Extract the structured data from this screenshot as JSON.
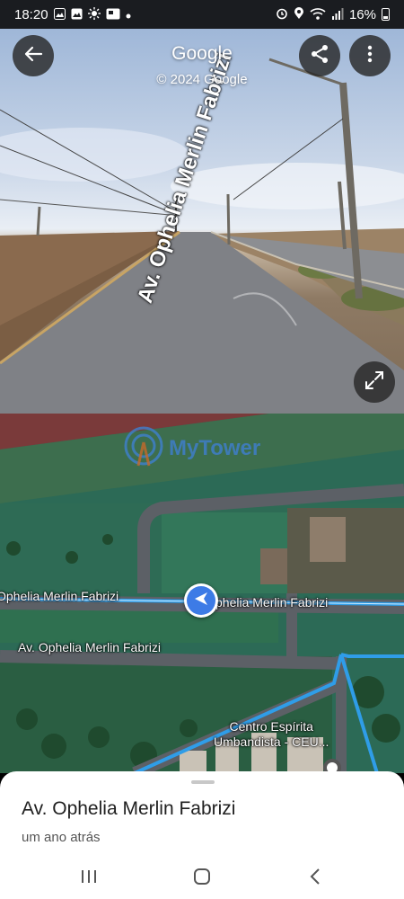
{
  "status_bar": {
    "time": "18:20",
    "left_icons": [
      "gallery-icon",
      "photo-icon",
      "brightness-icon",
      "image-icon",
      "dot-icon"
    ],
    "right_icons": [
      "alarm-icon",
      "location-icon",
      "wifi-icon",
      "signal-icon"
    ],
    "battery_percent": "16%"
  },
  "street_view": {
    "brand": "Google",
    "copyright": "© 2024 Google",
    "road_label": "Av. Ophelia Merlin Fabrizi",
    "buttons": {
      "back": "arrow-left-icon",
      "share": "share-icon",
      "more": "more-vert-icon",
      "expand": "expand-icon"
    }
  },
  "map": {
    "watermark": "MyTower",
    "street_labels": [
      "Ophelia Merlin Fabrizi",
      "Av. Ophelia Merlin Fabrizi"
    ],
    "street_label_left": "Ophelia Merlin Fabrizi",
    "street_label_right": "phelia Merlin Fabrizi",
    "street_label_lower": "Av. Ophelia Merlin Fabrizi",
    "place_label_line1": "Centro Espírita",
    "place_label_line2": "Umbandista - CEU...",
    "colors": {
      "route": "#2f9de8",
      "pegman": "#3d7be6"
    }
  },
  "bottom_sheet": {
    "title": "Av. Ophelia Merlin Fabrizi",
    "subtitle": "um ano atrás"
  },
  "nav_bar": {
    "recent": "recent-apps-icon",
    "home": "home-icon",
    "back": "back-icon"
  }
}
